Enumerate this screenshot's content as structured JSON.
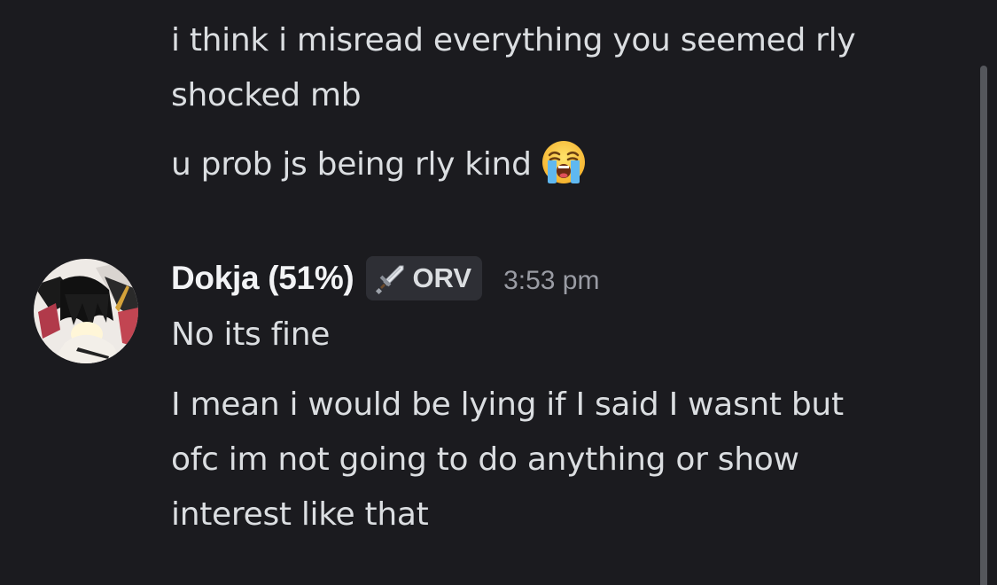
{
  "messages_prev": [
    "i think i misread everything you seemed rly",
    "shocked mb",
    "u prob js being rly kind"
  ],
  "emoji": "loudly-crying-face",
  "author": {
    "name": "Dokja (51%)",
    "tag": "ORV",
    "tag_icon": "sword-icon",
    "timestamp": "3:53 pm"
  },
  "messages": [
    "No its fine",
    "I mean i would be lying if I said I wasnt but",
    "ofc im not going to do anything or show",
    "interest like that"
  ],
  "colors": {
    "background": "#1b1b1f",
    "text": "#dbdee1",
    "username": "#f2f3f5",
    "timestamp": "#9a9ca4",
    "tag_bg": "#2e2f35"
  }
}
